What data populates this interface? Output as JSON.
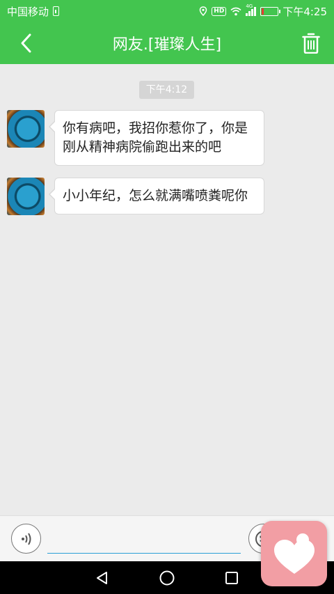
{
  "status_bar": {
    "carrier": "中国移动",
    "network_tag": "4G",
    "time": "下午4:25",
    "battery_level": 0.12,
    "battery_color": "#e53935"
  },
  "header": {
    "title": "网友.[璀璨人生]",
    "back_icon": "chevron-left-icon",
    "delete_icon": "trash-icon",
    "color": "#43c54f"
  },
  "chat": {
    "timestamp": "下午4:12",
    "messages": [
      {
        "text": "你有病吧，我招你惹你了，你是刚从精神病院偷跑出来的吧",
        "sender": "other"
      },
      {
        "text": "小小年纪，怎么就满嘴喷粪呢你",
        "sender": "other"
      }
    ]
  },
  "input_bar": {
    "value": "",
    "placeholder": "",
    "voice_icon": "voice-icon",
    "emoji_icon": "emoji-icon"
  },
  "nav": {
    "back_icon": "triangle-back-icon",
    "home_icon": "circle-home-icon",
    "recents_icon": "square-recents-icon"
  },
  "floating_app": {
    "icon": "heart-person-icon",
    "color": "#f29ea4"
  }
}
